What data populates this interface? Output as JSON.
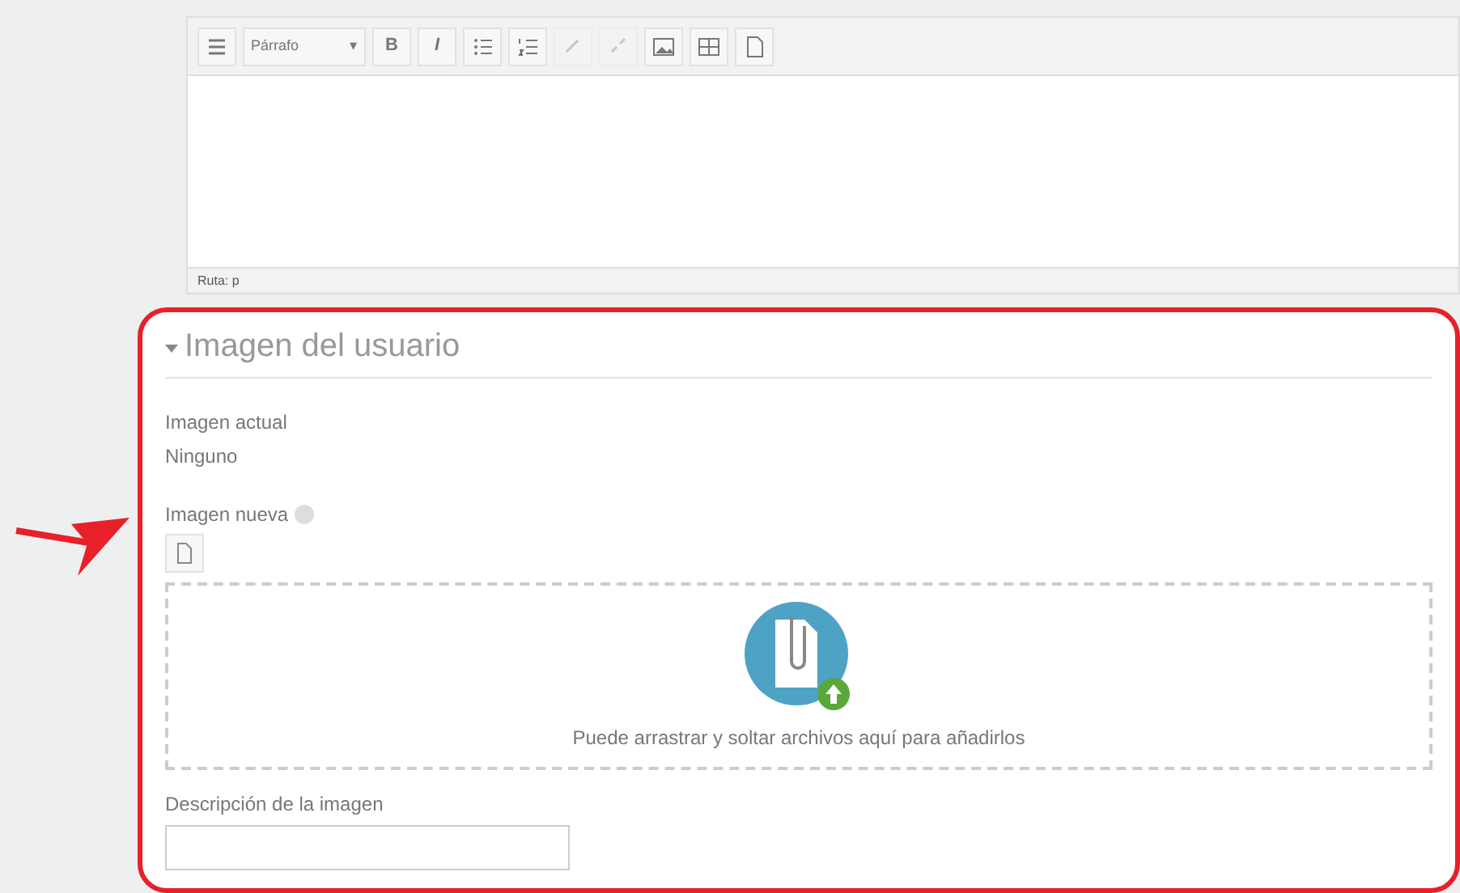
{
  "editor": {
    "toolbar": [
      {
        "kind": "toggle",
        "disabled": false
      },
      {
        "kind": "format",
        "label": "Párrafo",
        "caret": "▾",
        "disabled": false
      },
      {
        "kind": "text",
        "label": "B",
        "disabled": false
      },
      {
        "kind": "text",
        "label": "I",
        "disabled": false
      },
      {
        "kind": "bullets",
        "disabled": false
      },
      {
        "kind": "numbers",
        "disabled": false
      },
      {
        "kind": "link",
        "disabled": true
      },
      {
        "kind": "unlink",
        "disabled": true
      },
      {
        "kind": "image",
        "disabled": false
      },
      {
        "kind": "media",
        "disabled": false
      },
      {
        "kind": "files",
        "disabled": false
      }
    ],
    "path": "Ruta: p"
  },
  "section": {
    "title": "Imagen del usuario",
    "expanded": true,
    "highlighted": true,
    "current_label": "Imagen actual",
    "current_value": "Ninguno",
    "new_label": "Imagen nueva",
    "dropzone_text": "Puede arrastrar y soltar archivos aquí para añadirlos",
    "description_label": "Descripción de la imagen"
  }
}
